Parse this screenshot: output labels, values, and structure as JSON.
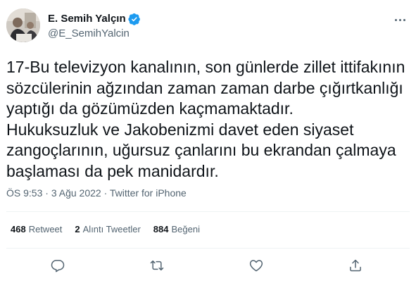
{
  "colors": {
    "verified": "#1d9bf0",
    "text_primary": "#0f1419",
    "text_secondary": "#536471",
    "divider": "#eff3f4"
  },
  "author": {
    "display_name": "E. Semih Yalçın",
    "handle": "@E_SemihYalcin",
    "verified": true
  },
  "tweet": {
    "text": "17-Bu televizyon kanalının, son günlerde zillet ittifakının\nsözcülerinin ağzından zaman zaman darbe çığırtkanlığı\nyaptığı da gözümüzden kaçmamaktadır.\nHukuksuzluk ve Jakobenizmi davet eden siyaset\nzangoçlarının, uğursuz çanlarını bu ekrandan çalmaya\nbaşlaması da pek manidardır.",
    "time": "ÖS 9:53",
    "separator": "·",
    "date": "3 Ağu 2022",
    "source": "Twitter for iPhone"
  },
  "stats": {
    "retweets_count": "468",
    "retweets_label": "Retweet",
    "quotes_count": "2",
    "quotes_label": "Alıntı Tweetler",
    "likes_count": "884",
    "likes_label": "Beğeni"
  },
  "actions": {
    "reply_icon": "reply-icon",
    "retweet_icon": "retweet-icon",
    "like_icon": "heart-icon",
    "share_icon": "share-icon"
  }
}
